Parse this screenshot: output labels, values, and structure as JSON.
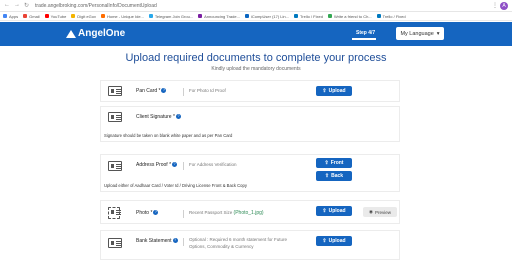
{
  "browser": {
    "url": "trade.angelbroking.com/PersonalInfo/DocumentUpload",
    "profile_initial": "A",
    "bookmarks": [
      {
        "label": "Apps",
        "color": "#4285f4"
      },
      {
        "label": "Gmail",
        "color": "#ea4335"
      },
      {
        "label": "YouTube",
        "color": "#ff0000"
      },
      {
        "label": "Digit eGov",
        "color": "#f4b400"
      },
      {
        "label": "Home - Unique Ide...",
        "color": "#ff6d00"
      },
      {
        "label": "Telegram Join Grou...",
        "color": "#29a9eb"
      },
      {
        "label": "Announcing Trade...",
        "color": "#7b1fa2"
      },
      {
        "label": "iCompUser (17) Lin...",
        "color": "#0a66c2"
      },
      {
        "label": "Trello / Fixed",
        "color": "#0079bf"
      },
      {
        "label": "Write a friend to Ch...",
        "color": "#34a853"
      },
      {
        "label": "Trello / Fixed",
        "color": "#0079bf"
      }
    ]
  },
  "header": {
    "logo_text": "AngelOne",
    "step": "Step 4/7",
    "language_label": "My Language"
  },
  "main": {
    "title": "Upload required documents to complete your process",
    "subtitle": "Kindly upload the mandatory documents"
  },
  "documents": {
    "pan": {
      "label": "Pan Card *",
      "desc": "For Photo Id Proof",
      "button": "Upload"
    },
    "signature": {
      "label": "Client Signature *",
      "note": "Signature should be taken on blank white paper and as per Pan Card"
    },
    "address": {
      "label": "Address Proof *",
      "desc": "For Address Verification",
      "front": "Front",
      "back": "Back",
      "note": "Upload either of Aadhaar Card / Voter Id / Driving License Front & Back Copy"
    },
    "photo": {
      "label": "Photo *",
      "desc": "Recent Passport Size",
      "sample": "(Photo_1.jpg)",
      "button": "Upload",
      "preview": "Preview"
    },
    "bank": {
      "label": "Bank Statement",
      "desc_line1": "Optional : Required 6 month statement for Future",
      "desc_line2": "Options, Commodity & Currency",
      "button": "Upload"
    }
  },
  "help_badge": "?"
}
